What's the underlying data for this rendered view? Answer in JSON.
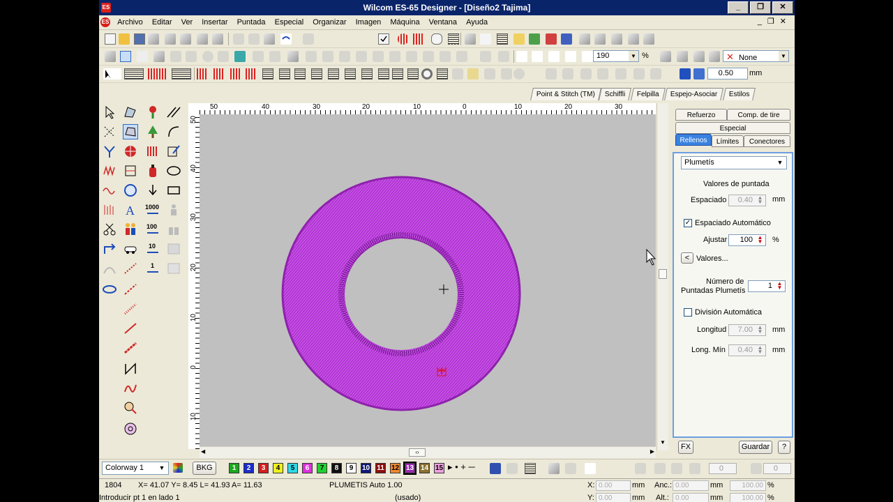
{
  "window": {
    "title": "Wilcom ES-65 Designer - [Diseño2          Tajima]",
    "app_badge": "ES"
  },
  "menu": [
    "Archivo",
    "Editar",
    "Ver",
    "Insertar",
    "Puntada",
    "Especial",
    "Organizar",
    "Imagen",
    "Máquina",
    "Ventana",
    "Ayuda"
  ],
  "toolbar": {
    "zoom_value": "190",
    "zoom_unit": "%",
    "none_label": "None",
    "stitch_value": "0.50",
    "stitch_unit": "mm"
  },
  "stitch_tabs": [
    "Point & Stitch (TM)",
    "Schiffli",
    "Felpilla",
    "Espejo-Asociar",
    "Estilos"
  ],
  "ruler": {
    "top_labels": [
      "50",
      "40",
      "30",
      "20",
      "10",
      "0",
      "10",
      "20",
      "30"
    ],
    "left_labels": [
      "50",
      "40",
      "30",
      "20",
      "10",
      "0",
      "10"
    ]
  },
  "colors": {
    "fill_outer": "#b030d0",
    "fill_dark": "#7a1a98",
    "canvas": "#c0c0c0",
    "accent": "#3a82e0"
  },
  "panel": {
    "tabs_row1": [
      "Refuerzo",
      "Comp. de tire"
    ],
    "tabs_row2": [
      "Especial"
    ],
    "tabs_row3": [
      "Rellenos",
      "Límites",
      "Conectores"
    ],
    "fill_type": "Plumetís",
    "section_title": "Valores de puntada",
    "spacing_label": "Espaciado",
    "spacing_value": "0.40",
    "spacing_unit": "mm",
    "auto_spacing_label": "Espaciado Automático",
    "adjust_label": "Ajustar",
    "adjust_value": "100",
    "adjust_unit": "%",
    "values_button": "Valores...",
    "values_arrow": "<",
    "count_label_1": "Número de",
    "count_label_2": "Puntadas Plumetís",
    "count_value": "1",
    "auto_split_label": "División Automática",
    "length_label": "Longitud",
    "length_value": "7.00",
    "length_unit": "mm",
    "minlen_label": "Long. Mín",
    "minlen_value": "0.40",
    "minlen_unit": "mm",
    "fx_button": "FX",
    "save_button": "Guardar",
    "help_button": "?"
  },
  "colorbar": {
    "colorway": "Colorway 1",
    "bkg": "BKG",
    "swatches": [
      {
        "n": "1",
        "c": "#1ca81c",
        "t": "#fff"
      },
      {
        "n": "2",
        "c": "#1c2cc8",
        "t": "#fff"
      },
      {
        "n": "3",
        "c": "#d81c1c",
        "t": "#fff"
      },
      {
        "n": "4",
        "c": "#f0f020",
        "t": "#000"
      },
      {
        "n": "5",
        "c": "#30d8e8",
        "t": "#000"
      },
      {
        "n": "6",
        "c": "#e030e0",
        "t": "#fff"
      },
      {
        "n": "7",
        "c": "#20d030",
        "t": "#000"
      },
      {
        "n": "8",
        "c": "#101010",
        "t": "#fff"
      },
      {
        "n": "9",
        "c": "#ffffff",
        "t": "#000"
      },
      {
        "n": "10",
        "c": "#101878",
        "t": "#fff"
      },
      {
        "n": "11",
        "c": "#8a1010",
        "t": "#fff"
      },
      {
        "n": "12",
        "c": "#f08830",
        "t": "#000"
      },
      {
        "n": "13",
        "c": "#9a28b0",
        "t": "#fff"
      },
      {
        "n": "14",
        "c": "#8a7030",
        "t": "#fff"
      },
      {
        "n": "15",
        "c": "#f0a0e0",
        "t": "#000"
      }
    ],
    "zero1": "0",
    "zero2": "0"
  },
  "status": {
    "stitch_count": "1804",
    "coords": "X=  41.07 Y=    8.45 L=  41.93 A=  11.63",
    "fill_info": "PLUMETIS Auto   1.00",
    "prompt": "Introducir pt 1 en lado 1",
    "used": "(usado)",
    "x_label": "X:",
    "x_value": "0.00",
    "x_unit": "mm",
    "y_label": "Y:",
    "y_value": "0.00",
    "y_unit": "mm",
    "w_label": "Anc.:",
    "w_value": "0.00",
    "w_unit": "mm",
    "h_label": "Alt.:",
    "h_value": "0.00",
    "h_unit": "mm",
    "pw_value": "100.00",
    "pw_unit": "%",
    "ph_value": "100.00",
    "ph_unit": "%"
  }
}
